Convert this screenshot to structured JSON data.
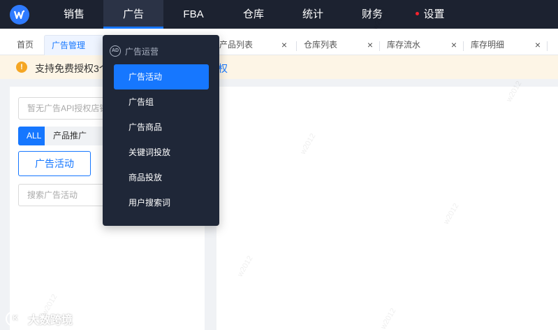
{
  "nav": {
    "items": [
      {
        "label": "销售"
      },
      {
        "label": "广告"
      },
      {
        "label": "FBA"
      },
      {
        "label": "仓库"
      },
      {
        "label": "统计"
      },
      {
        "label": "财务"
      },
      {
        "label": "设置"
      }
    ],
    "active": "广告"
  },
  "tabs": [
    {
      "label": "首页"
    },
    {
      "label": "广告管理"
    },
    {
      "label": "产品列表"
    },
    {
      "label": "仓库列表"
    },
    {
      "label": "库存流水"
    },
    {
      "label": "库存明细"
    }
  ],
  "notice": {
    "text": "支持免费授权3个",
    "link": "权"
  },
  "left_panel": {
    "store_placeholder": "暂无广告API授权店铺",
    "seg_all": "ALL",
    "seg_product": "产品推广",
    "campaign_button": "广告活动",
    "search_placeholder": "搜索广告活动"
  },
  "dropdown": {
    "header": "广告运营",
    "header_icon_text": "AD",
    "items": [
      {
        "label": "广告活动"
      },
      {
        "label": "广告组"
      },
      {
        "label": "广告商品"
      },
      {
        "label": "关键词投放"
      },
      {
        "label": "商品投放"
      },
      {
        "label": "用户搜索词"
      }
    ]
  },
  "watermark": "w2012",
  "brand": "大数跨境",
  "brand_logo_text": "K",
  "colors": {
    "nav_bg": "#1c2230",
    "accent": "#1677ff",
    "dropdown_bg": "#1f2738",
    "notice_bg": "#fdf5e6",
    "warn": "#f5a623"
  }
}
